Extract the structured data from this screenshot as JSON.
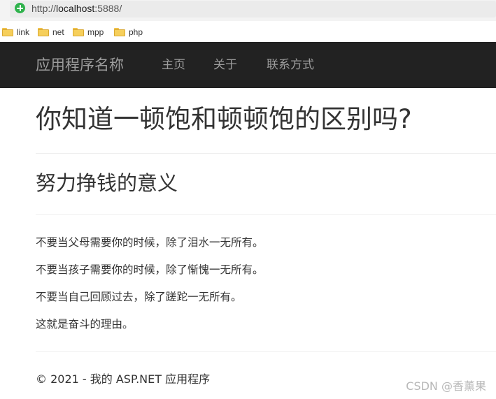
{
  "browser": {
    "url_prefix": "http://",
    "url_host": "localhost",
    "url_rest": ":5888/",
    "bookmarks": [
      {
        "label": "link",
        "icon": "folder-icon"
      },
      {
        "label": "net",
        "icon": "folder-icon"
      },
      {
        "label": "mpp",
        "icon": "folder-icon"
      },
      {
        "label": "php",
        "icon": "folder-icon"
      }
    ]
  },
  "navbar": {
    "brand": "应用程序名称",
    "links": [
      "主页",
      "关于",
      "联系方式"
    ],
    "background": "#222222",
    "link_color": "#9d9d9d"
  },
  "main": {
    "title": "你知道一顿饱和顿顿饱的区别吗?",
    "subtitle": "努力挣钱的意义",
    "paragraphs": [
      "不要当父母需要你的时候，除了泪水一无所有。",
      "不要当孩子需要你的时候，除了惭愧一无所有。",
      "不要当自己回顾过去，除了蹉跎一无所有。",
      "这就是奋斗的理由。"
    ]
  },
  "footer": {
    "text": "© 2021 - 我的 ASP.NET 应用程序"
  },
  "watermark": "CSDN @香薰果"
}
